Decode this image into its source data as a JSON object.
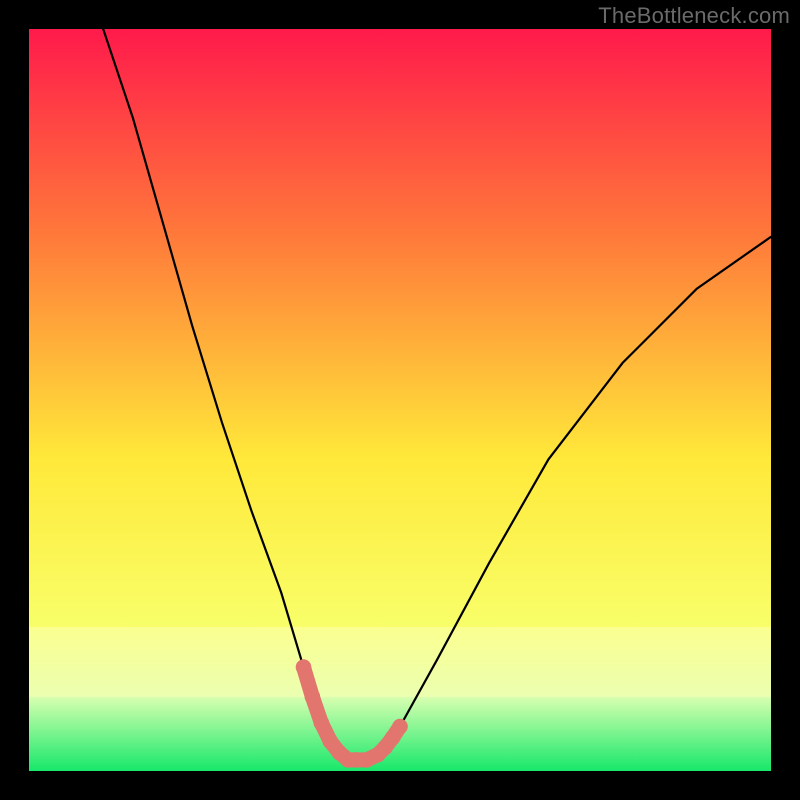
{
  "watermark": "TheBottleneck.com",
  "gradient": {
    "top": "#ff1a4b",
    "mid_upper": "#ff7a3a",
    "mid": "#ffe93a",
    "mid_lower": "#f8ff6a",
    "band_light": "#d8ffb0",
    "bottom": "#17e86b"
  },
  "curve_color": "#000000",
  "marker_color": "#e2766f",
  "chart_data": {
    "type": "line",
    "title": "",
    "xlabel": "",
    "ylabel": "",
    "xlim": [
      0,
      100
    ],
    "ylim": [
      0,
      100
    ],
    "series": [
      {
        "name": "bottleneck-curve",
        "x": [
          10,
          14,
          18,
          22,
          26,
          30,
          34,
          37,
          39.5,
          41.5,
          43,
          45,
          48,
          50,
          55,
          62,
          70,
          80,
          90,
          100
        ],
        "y": [
          100,
          88,
          74,
          60,
          47,
          35,
          24,
          14,
          7,
          3,
          1.5,
          1.5,
          2.5,
          6,
          15,
          28,
          42,
          55,
          65,
          72
        ]
      }
    ],
    "markers": {
      "name": "highlight-segment",
      "x": [
        37,
        38.2,
        39.4,
        40.6,
        41.8,
        43,
        44,
        45.5,
        47,
        48,
        49,
        50
      ],
      "y": [
        14,
        10,
        6.5,
        4,
        2.5,
        1.5,
        1.5,
        1.5,
        2.2,
        3.2,
        4.5,
        6
      ]
    }
  }
}
